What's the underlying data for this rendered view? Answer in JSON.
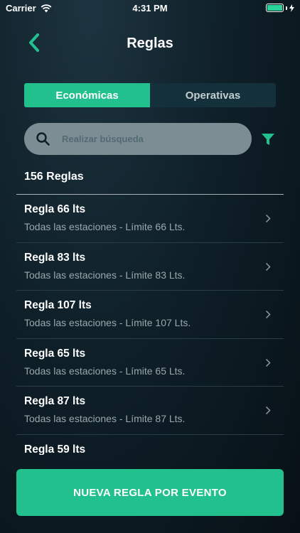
{
  "status_bar": {
    "carrier": "Carrier",
    "time": "4:31 PM"
  },
  "header": {
    "title": "Reglas"
  },
  "tabs": [
    {
      "label": "Económicas",
      "active": true
    },
    {
      "label": "Operativas",
      "active": false
    }
  ],
  "search": {
    "placeholder": "Realizar búsqueda",
    "value": ""
  },
  "list": {
    "count_label": "156 Reglas",
    "items": [
      {
        "title": "Regla 66 lts",
        "subtitle": "Todas las estaciones - Límite 66 Lts."
      },
      {
        "title": "Regla 83 lts",
        "subtitle": "Todas las estaciones - Límite 83 Lts."
      },
      {
        "title": "Regla 107 lts",
        "subtitle": "Todas las estaciones - Límite 107 Lts."
      },
      {
        "title": "Regla 65 lts",
        "subtitle": "Todas las estaciones - Límite 65 Lts."
      },
      {
        "title": "Regla 87 lts",
        "subtitle": "Todas las estaciones - Límite 87 Lts."
      },
      {
        "title": "Regla 59 lts",
        "subtitle": ""
      }
    ]
  },
  "cta": {
    "label": "NUEVA REGLA POR EVENTO"
  },
  "colors": {
    "accent": "#21c08c",
    "background": "#0f2029",
    "search_bg": "#7c8e94"
  },
  "icons": {
    "back": "chevron-left-icon",
    "search": "search-icon",
    "filter": "filter-icon",
    "row": "chevron-right-icon"
  }
}
